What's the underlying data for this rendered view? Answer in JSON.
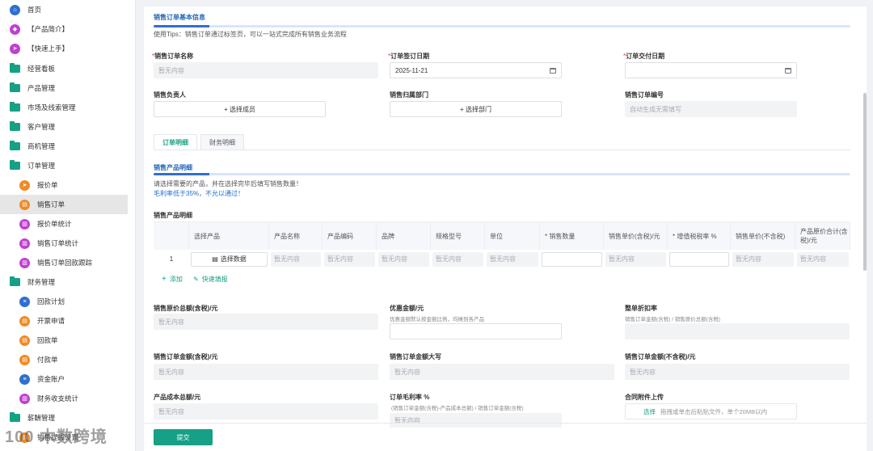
{
  "sidebar": {
    "items": [
      {
        "label": "首页",
        "icon": "home-icon",
        "type": "circle",
        "color": "#2f6fd0",
        "glyph": "⌂"
      },
      {
        "label": "【产品简介】",
        "icon": "tag-icon",
        "type": "circle",
        "color": "#c040d0",
        "glyph": "◆"
      },
      {
        "label": "【快速上手】",
        "icon": "send-icon",
        "type": "circle",
        "color": "#c040d0",
        "glyph": "➤"
      },
      {
        "label": "经营看板",
        "icon": "folder-icon",
        "type": "folder"
      },
      {
        "label": "产品管理",
        "icon": "folder-icon",
        "type": "folder"
      },
      {
        "label": "市场及线索管理",
        "icon": "folder-icon",
        "type": "folder"
      },
      {
        "label": "客户管理",
        "icon": "folder-icon",
        "type": "folder"
      },
      {
        "label": "商机管理",
        "icon": "folder-icon",
        "type": "folder"
      },
      {
        "label": "订单管理",
        "icon": "folder-icon",
        "type": "folder"
      },
      {
        "label": "报价单",
        "icon": "send-icon",
        "type": "circle",
        "color": "#f08a24",
        "glyph": "➤",
        "sub": true
      },
      {
        "label": "销售订单",
        "icon": "document-icon",
        "type": "circle",
        "color": "#f08a24",
        "glyph": "▤",
        "sub": true,
        "active": true
      },
      {
        "label": "报价单统计",
        "icon": "chart-icon",
        "type": "circle",
        "color": "#c040d0",
        "glyph": "▥",
        "sub": true
      },
      {
        "label": "销售订单统计",
        "icon": "chart-icon",
        "type": "circle",
        "color": "#c040d0",
        "glyph": "▥",
        "sub": true
      },
      {
        "label": "销售订单回款跟踪",
        "icon": "chart-icon",
        "type": "circle",
        "color": "#c040d0",
        "glyph": "▥",
        "sub": true
      },
      {
        "label": "财务管理",
        "icon": "folder-icon",
        "type": "folder"
      },
      {
        "label": "回款计划",
        "icon": "list-icon",
        "type": "circle",
        "color": "#2f6fd0",
        "glyph": "≡",
        "sub": true
      },
      {
        "label": "开票申请",
        "icon": "document-icon",
        "type": "circle",
        "color": "#f08a24",
        "glyph": "▤",
        "sub": true
      },
      {
        "label": "回款单",
        "icon": "document-icon",
        "type": "circle",
        "color": "#f08a24",
        "glyph": "▤",
        "sub": true
      },
      {
        "label": "付款单",
        "icon": "document-icon",
        "type": "circle",
        "color": "#f08a24",
        "glyph": "▤",
        "sub": true
      },
      {
        "label": "资金账户",
        "icon": "list-icon",
        "type": "circle",
        "color": "#2f6fd0",
        "glyph": "≡",
        "sub": true
      },
      {
        "label": "财务收支统计",
        "icon": "chart-icon",
        "type": "circle",
        "color": "#c040d0",
        "glyph": "▥",
        "sub": true
      },
      {
        "label": "薪酬管理",
        "icon": "folder-icon",
        "type": "folder"
      },
      {
        "label": "销售提成设置",
        "icon": "document-icon",
        "type": "circle",
        "color": "#f08a24",
        "glyph": "▤",
        "sub": true
      }
    ]
  },
  "basic": {
    "title": "销售订单基本信息",
    "tip": "使用Tips：销售订单通过标签页，可以一站式完成所有销售业务流程",
    "order_name_label": "销售订单名称",
    "order_name_placeholder": "暂无内容",
    "sign_date_label": "订单签订日期",
    "sign_date_value": "2025-11-21",
    "delivery_date_label": "订单交付日期",
    "delivery_date_value": "",
    "owner_label": "销售负责人",
    "owner_button": "+ 选择成员",
    "dept_label": "销售归属部门",
    "dept_button": "+ 选择部门",
    "order_no_label": "销售订单编号",
    "order_no_placeholder": "自动生成无需填写",
    "required_mark": "*"
  },
  "tabs": [
    {
      "label": "订单明细",
      "active": true
    },
    {
      "label": "财务明细",
      "active": false
    }
  ],
  "detail": {
    "title": "销售产品明细",
    "tip1": "请选择需要的产品，并在选择完毕后填写销售数量！",
    "tip2": "毛利率低于35%，不允以通过！",
    "table_title": "销售产品明细",
    "columns": [
      "",
      "选择产品",
      "产品名称",
      "产品编码",
      "品牌",
      "规格型号",
      "单位",
      "* 销售数量",
      "销售单价(含税)/元",
      "* 增值税税率 %",
      "销售单价(不含税)",
      "产品原价合计(含税)/元"
    ],
    "row": {
      "index": "1",
      "select_button": "选择数据",
      "placeholder": "暂无内容"
    },
    "add_label": "添加",
    "quick_fill_label": "快速填报"
  },
  "summary": {
    "orig_total_label": "销售原价总额(含税)/元",
    "discount_label": "优惠金额/元",
    "discount_sub": "优惠金额默认按金额比例，均摊到各产品",
    "discount_rate_label": "整单折扣率",
    "discount_rate_sub": "销售订单金额(含税) / 销售原价总额(含税)",
    "order_amount_label": "销售订单金额(含税)/元",
    "order_amount_upper_label": "销售订单金额大写",
    "order_amount_ex_label": "销售订单金额(不含税)/元",
    "cost_total_label": "产品成本总额/元",
    "margin_label": "订单毛利率 %",
    "margin_sub": "(销售订单金额(含税)-产品成本总额) / 销售订单金额(含税)",
    "attach_label": "合同附件上传",
    "upload_link": "选择",
    "upload_hint": "拖拽或单击后粘贴文件，单个20MB以内",
    "placeholder": "暂无内容"
  },
  "submit_label": "提交",
  "watermark": "100 木数跨境",
  "colors": {
    "accent": "#16a085",
    "title_blue": "#1e63b5",
    "required": "#e53935"
  }
}
